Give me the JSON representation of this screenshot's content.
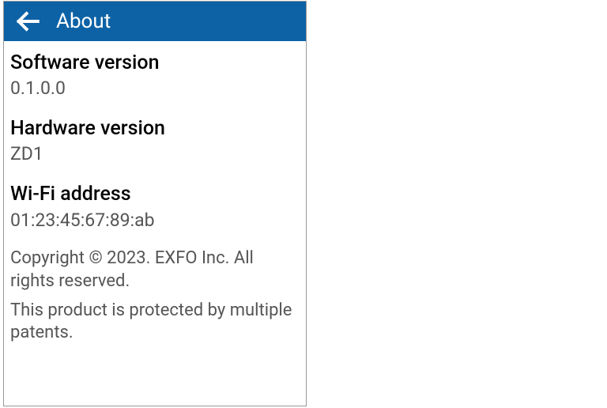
{
  "header": {
    "title": "About"
  },
  "info": {
    "software": {
      "label": "Software version",
      "value": "0.1.0.0"
    },
    "hardware": {
      "label": "Hardware version",
      "value": "ZD1"
    },
    "wifi": {
      "label": "Wi-Fi address",
      "value": "01:23:45:67:89:ab"
    }
  },
  "footer": {
    "copyright": "Copyright © 2023. EXFO Inc. All rights reserved.",
    "patents": "This product is protected by multiple patents."
  }
}
